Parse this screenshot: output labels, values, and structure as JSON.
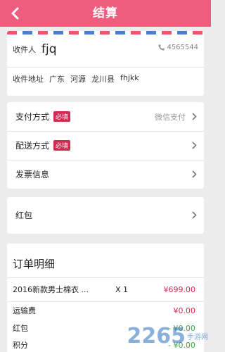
{
  "header": {
    "title": "结算"
  },
  "address": {
    "recipient_label": "收件人",
    "recipient_name": "fjq",
    "phone": "4565544",
    "address_label": "收件地址",
    "province": "广东",
    "city": "河源",
    "county": "龙川县",
    "detail": "fhjkk"
  },
  "options": {
    "payment_label": "支付方式",
    "payment_required": "必填",
    "payment_value": "微信支付",
    "delivery_label": "配送方式",
    "delivery_required": "必填",
    "invoice_label": "发票信息"
  },
  "red_packet": {
    "label": "红包"
  },
  "order": {
    "title": "订单明细",
    "item_name": "2016新款男士棉衣 ...",
    "item_qty": "X 1",
    "item_price": "¥699.00",
    "fees": [
      {
        "label": "运输费",
        "amount": "¥0.00"
      },
      {
        "label": "红包",
        "amount": "- ¥0.00"
      },
      {
        "label": "积分",
        "amount": "- ¥0.00"
      }
    ]
  },
  "watermark": {
    "text": "2265",
    "sub": "手游网"
  },
  "colors": {
    "accent": "#ee5c7e",
    "required_badge": "#d22a52",
    "discount": "#3aa64a"
  }
}
